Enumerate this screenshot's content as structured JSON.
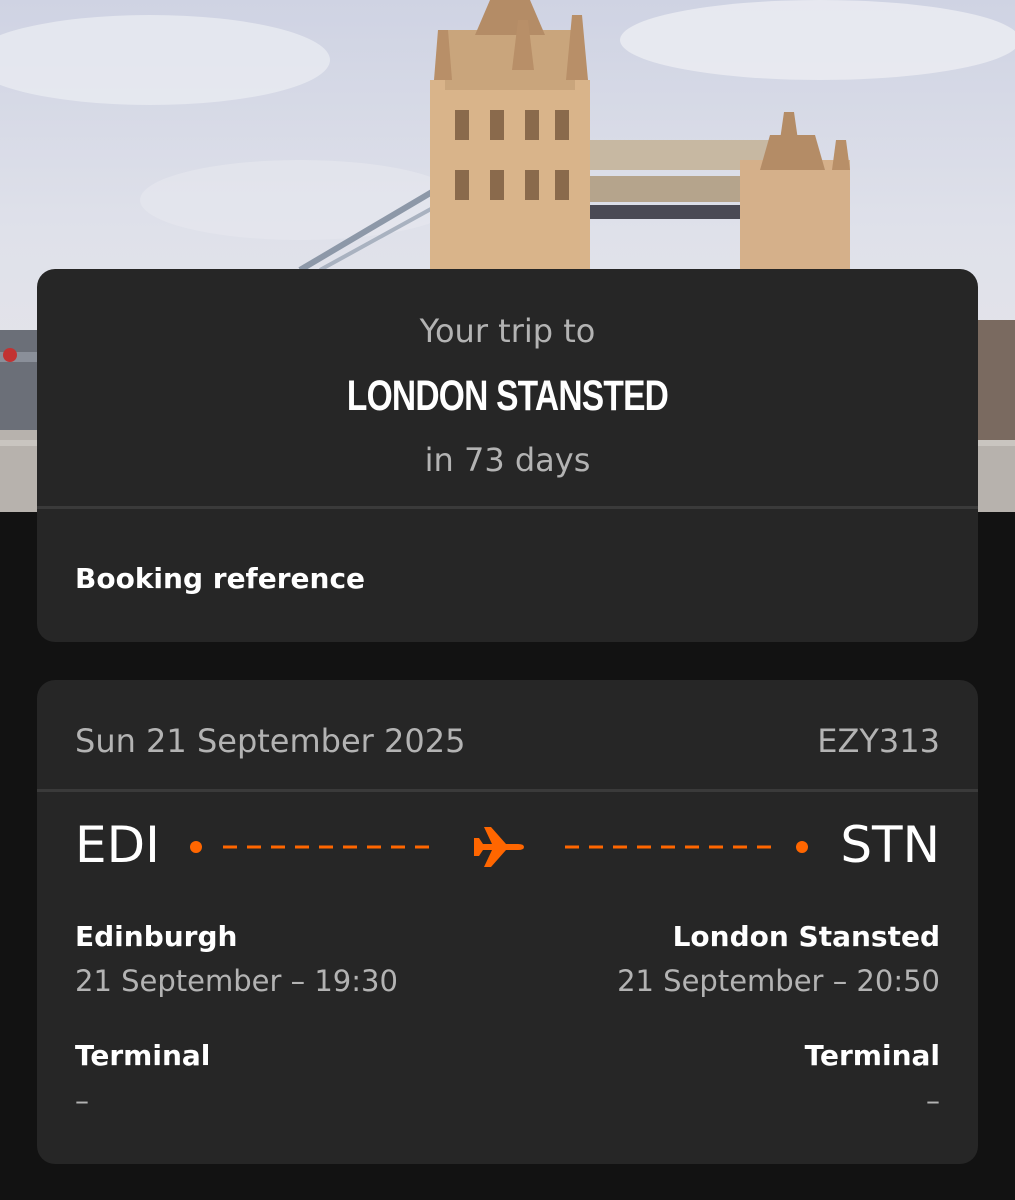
{
  "trip": {
    "pre_title": "Your trip to",
    "destination": "LONDON STANSTED",
    "countdown": "in 73 days",
    "booking_reference_label": "Booking reference"
  },
  "flight": {
    "date": "Sun 21 September 2025",
    "number": "EZY313",
    "from": {
      "code": "EDI",
      "city": "Edinburgh",
      "time": "21 September – 19:30",
      "terminal_label": "Terminal",
      "terminal_value": "–"
    },
    "to": {
      "code": "STN",
      "city": "London Stansted",
      "time": "21 September – 20:50",
      "terminal_label": "Terminal",
      "terminal_value": "–"
    }
  },
  "colors": {
    "accent": "#ff6600",
    "card": "#262626",
    "background": "#121212"
  },
  "icons": {
    "plane": "plane-icon",
    "hero": "tower-bridge-photo"
  }
}
